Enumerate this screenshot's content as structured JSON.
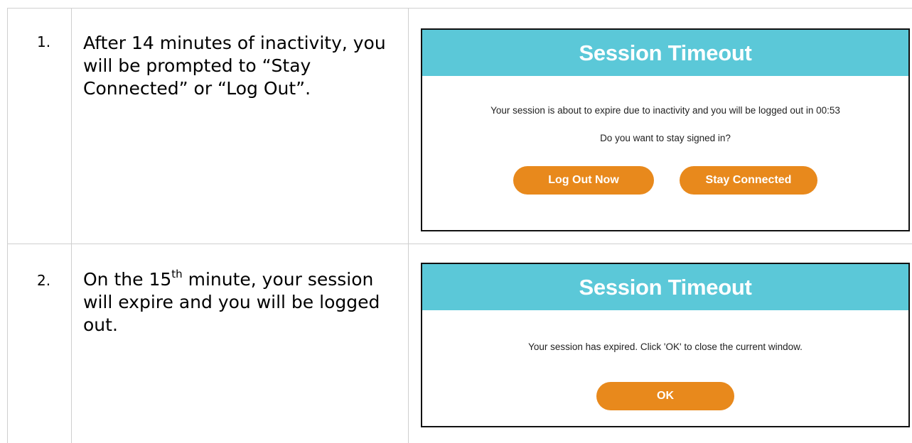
{
  "steps": [
    {
      "number": "1.",
      "text": "After 14 minutes of inactivity, you will be prompted to “Stay Connected” or “Log Out”.",
      "dialog": {
        "title": "Session Timeout",
        "message": "Your session is about to expire due to inactivity and you will be logged out in 00:53",
        "question": "Do you want to stay signed in?",
        "buttons": {
          "logout": "Log Out Now",
          "stay": "Stay Connected"
        }
      }
    },
    {
      "number": "2.",
      "text_pre": "On the 15",
      "text_sup": "th",
      "text_post": " minute, your session will expire and you will be logged out.",
      "dialog": {
        "title": "Session Timeout",
        "message": "Your session has expired. Click 'OK' to close the current window.",
        "buttons": {
          "ok": "OK"
        }
      }
    }
  ],
  "colors": {
    "header": "#5bc8d8",
    "button": "#e8891c",
    "grid": "#cfcfcf"
  }
}
